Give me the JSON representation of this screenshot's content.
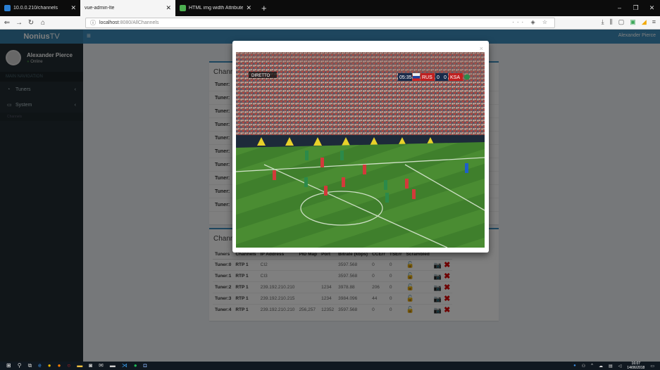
{
  "browser": {
    "tabs": [
      {
        "title": "10.0.0.210/channels",
        "favicon_color": "#2a7fd4"
      },
      {
        "title": "vue-admin-lte",
        "favicon_color": "#f5f5f5"
      },
      {
        "title": "HTML img width Attribute",
        "favicon_color": "#4caf50"
      }
    ],
    "url_host": "localhost",
    "url_rest": ":8080/AllChannels",
    "window_controls": [
      "–",
      "❐",
      "✕"
    ]
  },
  "app": {
    "brand_bold": "Nonius",
    "brand_light": "TV",
    "user_name": "Alexander Pierce",
    "user_status": "Online",
    "sidebar_header": "MAIN NAVIGATION",
    "sidebar_items": [
      {
        "label": "Tuners",
        "icon": "dashboard-icon"
      },
      {
        "label": "System",
        "icon": "laptop-icon"
      }
    ],
    "sidebar_footer": "Channels",
    "top_user": "Alexander Pierce"
  },
  "box1": {
    "title": "Channels",
    "rows": [
      "Tuner:",
      "Tuner:",
      "Tuner:",
      "Tuner:",
      "Tuner:",
      "Tuner:",
      "Tuner:",
      "Tuner:",
      "Tuner:",
      "Tuner:"
    ]
  },
  "box2": {
    "title": "Channels",
    "headers": [
      "Tuners",
      "Channels",
      "IP Address",
      "PID Map",
      "Port",
      "Bitrate (kbps)",
      "CCErr",
      "TSErr",
      "Scrambled"
    ],
    "rows": [
      {
        "tuner": "Tuner:0",
        "channel": "RTP 1",
        "ip": "CI2",
        "pid": "",
        "port": "",
        "bitrate": "3597.568",
        "ccerr": "0",
        "tserr": "0"
      },
      {
        "tuner": "Tuner:1",
        "channel": "RTP 1",
        "ip": "CI3",
        "pid": "",
        "port": "",
        "bitrate": "3597.568",
        "ccerr": "0",
        "tserr": "0"
      },
      {
        "tuner": "Tuner:2",
        "channel": "RTP 1",
        "ip": "239.192.210.210",
        "pid": "",
        "port": "1234",
        "bitrate": "3978.88",
        "ccerr": "206",
        "tserr": "0"
      },
      {
        "tuner": "Tuner:3",
        "channel": "RTP 1",
        "ip": "239.192.210.215",
        "pid": "",
        "port": "1234",
        "bitrate": "3984.096",
        "ccerr": "44",
        "tserr": "0"
      },
      {
        "tuner": "Tuner:4",
        "channel": "RTP 1",
        "ip": "239.192.210.210",
        "pid": "256,257",
        "port": "12352",
        "bitrate": "3597.568",
        "ccerr": "0",
        "tserr": "0"
      }
    ]
  },
  "modal": {
    "close": "×",
    "score": {
      "time": "05:35",
      "home": "RUS",
      "home_score": "0",
      "away_score": "0",
      "away": "KSA"
    },
    "overlay_tag": "DIRETTO"
  },
  "taskbar": {
    "time": "16:07",
    "date": "14/06/2018"
  },
  "colors": {
    "sidebar": "#222d32",
    "topbar": "#3c8dbc",
    "delete": "#dd0000",
    "pitch": "#3f7f2c"
  }
}
